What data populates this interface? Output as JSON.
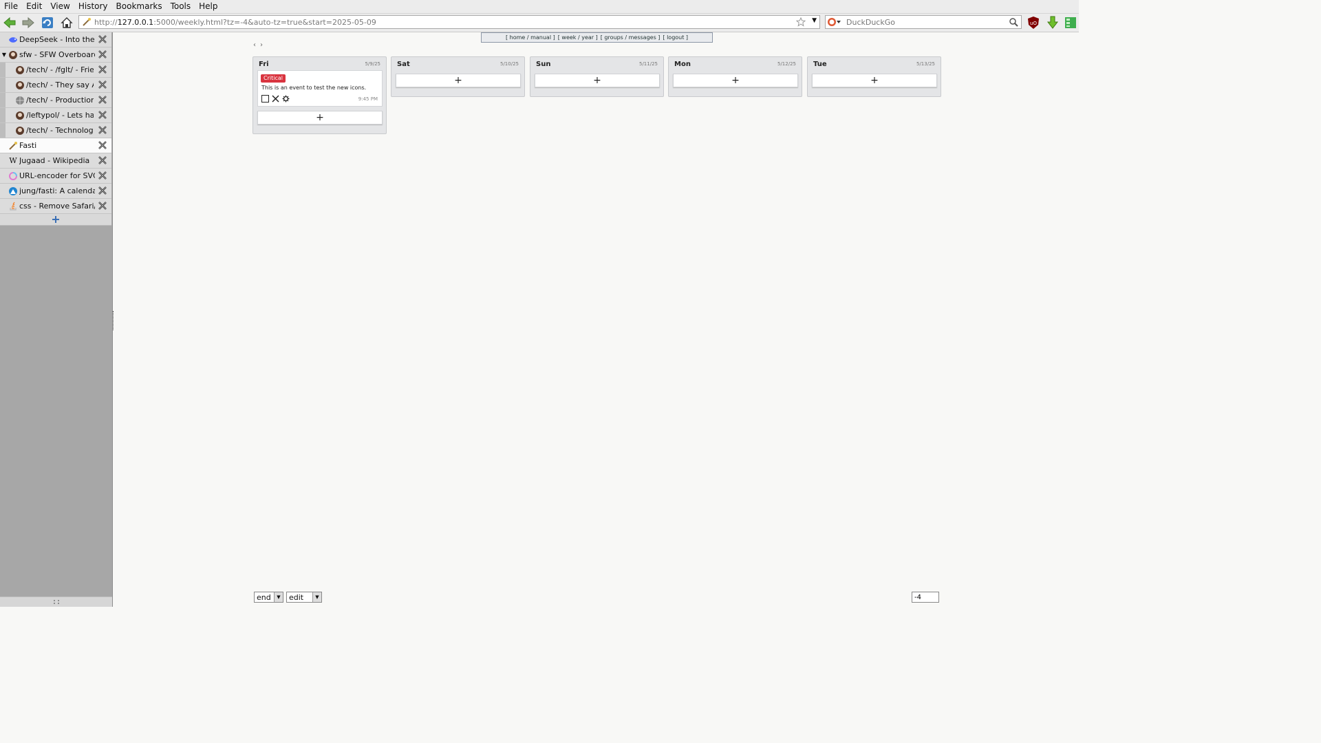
{
  "menubar": {
    "items": [
      {
        "label": "File"
      },
      {
        "label": "Edit"
      },
      {
        "label": "View"
      },
      {
        "label": "History"
      },
      {
        "label": "Bookmarks"
      },
      {
        "label": "Tools"
      },
      {
        "label": "Help"
      }
    ]
  },
  "toolbar": {
    "url_prefix": "http://",
    "url_host": "127.0.0.1",
    "url_rest": ":5000/weekly.html?tz=-4&auto-tz=true&start=2025-05-09",
    "search_placeholder": "DuckDuckGo"
  },
  "sidebar": {
    "tabs": [
      {
        "label": "DeepSeek - Into the Unknown",
        "icon": "deepseek-icon",
        "level": 0
      },
      {
        "label": "sfw - SFW Overboard",
        "icon": "overboard-icon",
        "level": 0,
        "expanded": true
      },
      {
        "label": "/tech/ - /fglt/ - Friendly",
        "icon": "board-icon",
        "level": 1
      },
      {
        "label": "/tech/ - They say AI",
        "icon": "board-icon",
        "level": 1
      },
      {
        "label": "/tech/ - Production S",
        "icon": "globe-icon",
        "level": 1
      },
      {
        "label": "/leftypol/ - Lets have",
        "icon": "board-icon",
        "level": 1
      },
      {
        "label": "/tech/ - Technology",
        "icon": "board-icon",
        "level": 1
      },
      {
        "label": "Fasti",
        "icon": "fasti-icon",
        "level": 0,
        "active": true
      },
      {
        "label": "Jugaad - Wikipedia",
        "icon": "wikipedia-icon",
        "level": 0
      },
      {
        "label": "URL-encoder for SVG",
        "icon": "svg-encoder-icon",
        "level": 0
      },
      {
        "label": "jung/fasti: A calendar s",
        "icon": "codeberg-icon",
        "level": 0
      },
      {
        "label": "css - Remove Safari/C",
        "icon": "stackoverflow-icon",
        "level": 0
      }
    ]
  },
  "topnav": {
    "links": [
      "home",
      "manual",
      "week",
      "year",
      "groups",
      "messages",
      "logout"
    ]
  },
  "pager": {
    "prev": "‹",
    "next": "›"
  },
  "days": [
    {
      "name": "Fri",
      "date": "5/9/25",
      "add_label": "+",
      "events": [
        {
          "badge": "Critical",
          "text": "This is an event to test the new icons.",
          "time": "9:45 PM"
        }
      ]
    },
    {
      "name": "Sat",
      "date": "5/10/25",
      "add_label": "+",
      "events": []
    },
    {
      "name": "Sun",
      "date": "5/11/25",
      "add_label": "+",
      "events": []
    },
    {
      "name": "Mon",
      "date": "5/12/25",
      "add_label": "+",
      "events": []
    },
    {
      "name": "Tue",
      "date": "5/13/25",
      "add_label": "+",
      "events": []
    }
  ],
  "controls": {
    "end_select": "end",
    "edit_select": "edit",
    "tz_value": "-4"
  },
  "colors": {
    "badge_critical": "#d9343f",
    "page_background": "#f8f8f6",
    "sidebar_background": "#a7a7a7"
  }
}
